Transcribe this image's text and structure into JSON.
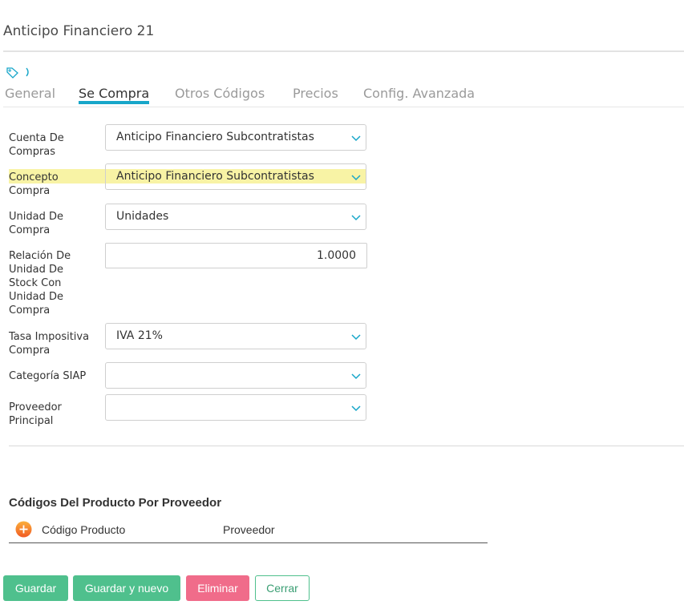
{
  "header": {
    "title": "Anticipo Financiero 21"
  },
  "tabs": [
    {
      "label": "General",
      "active": false
    },
    {
      "label": "Se Compra",
      "active": true
    },
    {
      "label": "Otros Códigos",
      "active": false
    },
    {
      "label": "Precios",
      "active": false
    },
    {
      "label": "Config. Avanzada",
      "active": false
    }
  ],
  "form": {
    "cuenta_compras": {
      "label": "Cuenta De Compras",
      "value": "Anticipo Financiero Subcontratistas"
    },
    "concepto_compra": {
      "label": "Concepto Compra",
      "value": "Anticipo Financiero Subcontratistas"
    },
    "unidad_compra": {
      "label": "Unidad De Compra",
      "value": "Unidades"
    },
    "relacion_unidad": {
      "label": "Relación De Unidad De Stock Con Unidad De Compra",
      "value": "1.0000"
    },
    "tasa_impositiva": {
      "label": "Tasa Impositiva Compra",
      "value": "IVA 21%"
    },
    "categoria_siap": {
      "label": "Categoría SIAP",
      "value": ""
    },
    "proveedor_principal": {
      "label": "Proveedor Principal",
      "value": ""
    }
  },
  "supplier_codes": {
    "title": "Códigos Del Producto Por Proveedor",
    "columns": [
      "Código Producto",
      "Proveedor"
    ]
  },
  "footer": {
    "save_label": "Guardar",
    "save_new_label": "Guardar y nuevo",
    "delete_label": "Eliminar",
    "close_label": "Cerrar"
  },
  "colors": {
    "accent": "#17a6c9",
    "save": "#4fc08d",
    "delete": "#f06c8a",
    "highlight": "#f8f3a5",
    "add": "#f7941d"
  },
  "icons": {
    "tag": "tag-icon",
    "chevron": "chevron-right-icon",
    "caret": "chevron-down-icon",
    "add": "plus-circle-icon"
  }
}
